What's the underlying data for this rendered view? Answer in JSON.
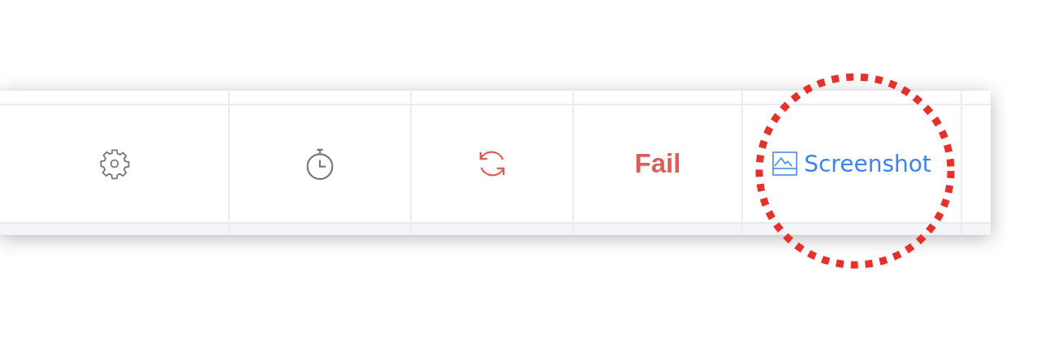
{
  "test_row": {
    "status": {
      "label": "Fail",
      "passed": false
    },
    "screenshot_link": {
      "label": "Screenshot"
    }
  }
}
